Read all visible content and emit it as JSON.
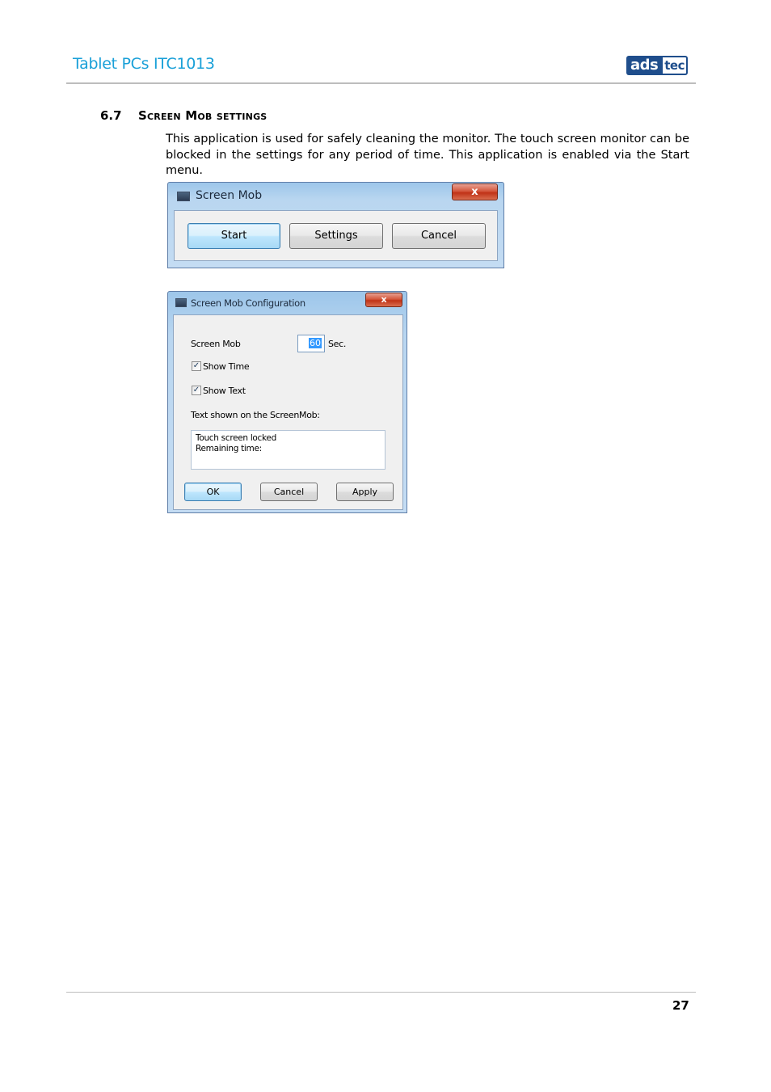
{
  "header": {
    "doc_title": "Tablet PCs ITC1013",
    "logo_left": "ads",
    "logo_right": "tec"
  },
  "section": {
    "number": "6.7",
    "title": "Screen Mob settings",
    "body": "This application is used for safely cleaning the monitor. The touch screen monitor can be blocked in the settings for any period of time. This application is enabled via the Start menu."
  },
  "dialog_main": {
    "title": "Screen Mob",
    "close_glyph": "x",
    "buttons": {
      "start": "Start",
      "settings": "Settings",
      "cancel": "Cancel"
    }
  },
  "dialog_config": {
    "title": "Screen Mob Configuration",
    "close_glyph": "x",
    "screen_mob_label": "Screen Mob",
    "seconds_value": "60",
    "seconds_unit": "Sec.",
    "show_time_label": "Show Time",
    "show_time_checked": true,
    "show_text_label": "Show Text",
    "show_text_checked": true,
    "text_label": "Text shown on the ScreenMob:",
    "text_line1": "Touch screen locked",
    "text_line2": "Remaining time:",
    "buttons": {
      "ok": "OK",
      "cancel": "Cancel",
      "apply": "Apply"
    }
  },
  "footer": {
    "page_number": "27"
  },
  "colors": {
    "title_blue": "#1aa0d8",
    "logo_blue": "#1f4e8c"
  }
}
